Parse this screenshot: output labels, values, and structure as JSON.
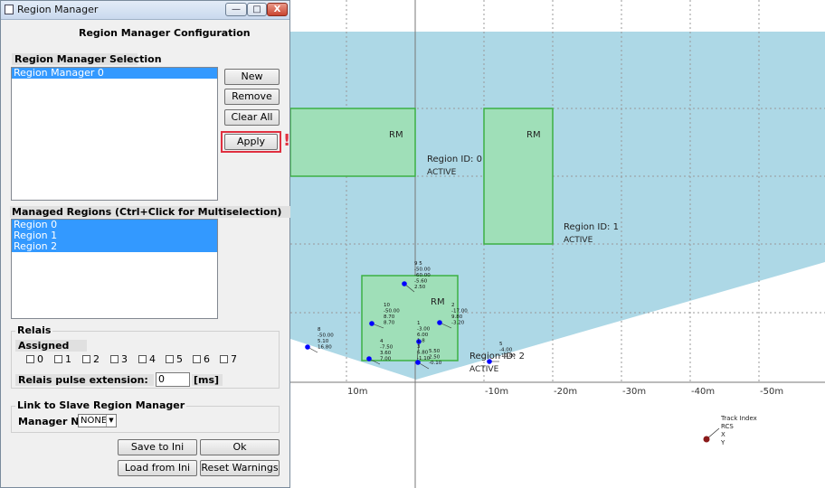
{
  "window": {
    "title": "Region Manager",
    "minimize_label": "—",
    "maximize_label": "□",
    "close_label": "X"
  },
  "config_title": "Region Manager Configuration",
  "selection": {
    "heading": "Region Manager Selection",
    "items": [
      "Region Manager 0"
    ],
    "new_label": "New",
    "remove_label": "Remove",
    "clear_label": "Clear All",
    "apply_label": "Apply",
    "warning_mark": "!"
  },
  "managed": {
    "heading": "Managed Regions (Ctrl+Click for Multiselection)",
    "items": [
      "Region 0",
      "Region 1",
      "Region 2"
    ]
  },
  "relais": {
    "heading": "Relais",
    "assigned_label": "Assigned",
    "checkboxes": [
      "0",
      "1",
      "2",
      "3",
      "4",
      "5",
      "6",
      "7"
    ],
    "pulse_label": "Relais pulse extension:",
    "pulse_value": "0",
    "pulse_unit": "[ms]"
  },
  "link": {
    "heading": "Link to Slave Region Manager",
    "manager_label": "Manager Nr.",
    "manager_value": "NONE"
  },
  "buttons": {
    "save": "Save to Ini",
    "ok": "Ok",
    "load": "Load from Ini",
    "reset": "Reset Warnings"
  },
  "plot": {
    "colors": {
      "coverage": "#add8e6",
      "region_fill": "#9fdfb8",
      "region_stroke": "#3cb043",
      "target": "#0000ff",
      "legend_point": "#8b1a1a",
      "grid": "#999999"
    },
    "x_ticks": [
      "10m",
      "-10m",
      "-20m",
      "-30m",
      "-40m",
      "-50m"
    ],
    "regions": [
      {
        "label": "RM",
        "id_text": "Region ID: 0",
        "status": "ACTIVE"
      },
      {
        "label": "RM",
        "id_text": "Region ID: 1",
        "status": "ACTIVE"
      },
      {
        "label": "RM",
        "id_text": "Region ID: 2",
        "status": "ACTIVE"
      }
    ],
    "partial_region_label": "RM",
    "targets": [
      {
        "lines": [
          "9 5",
          "-50.00",
          "-60.00",
          "-5.60",
          "2.50"
        ]
      },
      {
        "lines": [
          "10",
          "-50.00",
          "8.70",
          "8.70"
        ]
      },
      {
        "lines": [
          "2",
          "-17.00",
          "9.80",
          "-3.20"
        ]
      },
      {
        "lines": [
          "1",
          "-3.00",
          "6.00",
          "1.8",
          "3",
          "6.80",
          "-1.10"
        ]
      },
      {
        "lines": [
          "8",
          "-50.00",
          "5.10",
          "16.80"
        ]
      },
      {
        "lines": [
          "4",
          "-7.50",
          "3.60",
          "7.00"
        ]
      },
      {
        "lines": [
          "5.50",
          "2.50",
          "-0.10"
        ]
      },
      {
        "lines": [
          "5",
          "-4.00",
          "-10.80"
        ]
      }
    ],
    "legend": {
      "lines": [
        "Track Index",
        "RCS",
        "X",
        "Y"
      ]
    }
  }
}
